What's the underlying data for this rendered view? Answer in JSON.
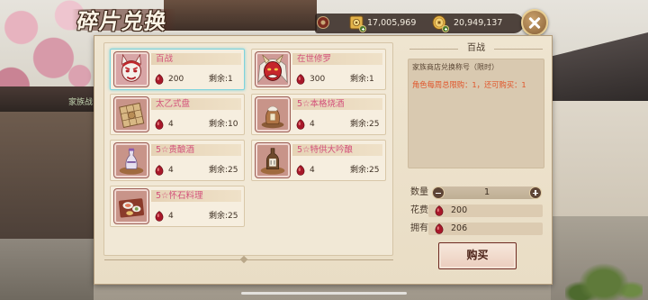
{
  "title": "碎片兑换",
  "background_sign": "家族战",
  "top_bar": {
    "ornament_icon": "bar-ornament-icon",
    "currencies": [
      {
        "icon": "jade-currency-icon",
        "add_icon": "add-currency-icon",
        "amount": "17,005,969"
      },
      {
        "icon": "gold-coin-icon",
        "add_icon": "add-currency-icon",
        "amount": "20,949,137"
      }
    ],
    "close_icon": "close-icon"
  },
  "price_currency_icon": "red-gem-icon",
  "items": [
    {
      "name": "百战",
      "icon": "oni-mask-icon",
      "price": "200",
      "remaining": "剩余:1",
      "selected": true
    },
    {
      "name": "在世修罗",
      "icon": "hannya-mask-icon",
      "price": "300",
      "remaining": "剩余:1",
      "selected": false
    },
    {
      "name": "太乙式盘",
      "icon": "divination-board-icon",
      "price": "4",
      "remaining": "剩余:10",
      "selected": false
    },
    {
      "name": "5☆本格烧酒",
      "icon": "shochu-jar-icon",
      "price": "4",
      "remaining": "剩余:25",
      "selected": false
    },
    {
      "name": "5☆贵酿酒",
      "icon": "sake-bottle-icon",
      "price": "4",
      "remaining": "剩余:25",
      "selected": false
    },
    {
      "name": "5☆特供大吟酿",
      "icon": "daiginjo-bottle-icon",
      "price": "4",
      "remaining": "剩余:25",
      "selected": false
    },
    {
      "name": "5☆怀石料理",
      "icon": "kaiseki-dish-icon",
      "price": "4",
      "remaining": "剩余:25",
      "selected": false
    }
  ],
  "detail": {
    "title": "百战",
    "description": "家族商店兑换称号（限时）",
    "limit": "角色每周总限购：1，还可购买：1"
  },
  "purchase": {
    "quantity_label": "数量",
    "quantity": "1",
    "decrease_icon": "minus-icon",
    "increase_icon": "plus-icon",
    "cost_label": "花费",
    "cost": "200",
    "owned_label": "拥有",
    "owned": "206",
    "buy_label": "购买"
  },
  "colors": {
    "name_text": "#d3507a",
    "limit_text": "#e0552a",
    "selected_border": "#7fd3dc",
    "panel": "#ede2cb"
  }
}
